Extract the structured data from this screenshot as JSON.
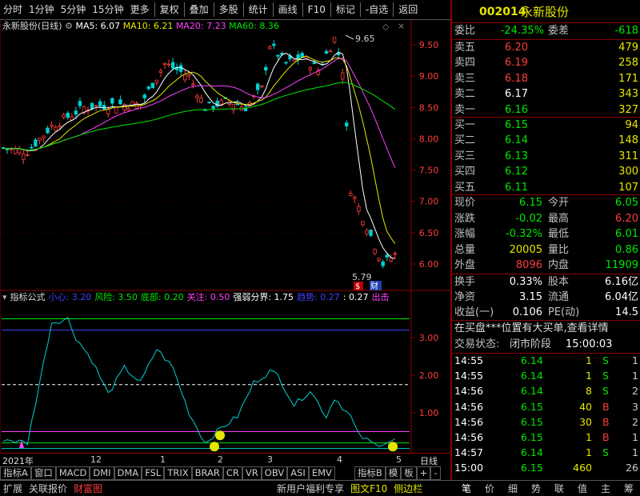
{
  "toolbar": [
    "分时",
    "1分钟",
    "5分钟",
    "15分钟",
    "更多",
    "复权",
    "叠加",
    "多股",
    "统计",
    "画线",
    "F10",
    "标记",
    "-自选",
    "返回"
  ],
  "ma": {
    "title": "永新股份(日线)",
    "ma5": "MA5: 6.07",
    "ma10": "MA10: 6.21",
    "ma20": "MA20: 7.23",
    "ma60": "MA60: 8.36"
  },
  "colors": {
    "up": "#ff3c3c",
    "down": "#00e600",
    "ma5": "#ffffff",
    "ma10": "#e6e600",
    "ma20": "#ff40ff",
    "ma60": "#00e600",
    "axis": "#8b0000",
    "grid": "#8b0000"
  },
  "price_axis": [
    "9.50",
    "9.00",
    "8.50",
    "8.00",
    "7.50",
    "7.00",
    "6.50",
    "6.00"
  ],
  "markers": {
    "high": "9.65",
    "low": "5.79",
    "s": "$",
    "cai": "财"
  },
  "ind": {
    "title": "指标公式",
    "xiaoxin": "小心: 3.20",
    "fengxian": "风险: 3.50",
    "dibu": "底部: 0.20",
    "guanzhu": "关注: 0.50",
    "qiangruo": "强弱分界: 1.75",
    "qushi": "趋势: 0.27",
    "v": ": 0.27",
    "chuji": "出击"
  },
  "ind_axis": [
    "3.00",
    "2.00",
    "1.00"
  ],
  "dates": [
    "2021年",
    "12",
    "1",
    "2",
    "3",
    "4",
    "5"
  ],
  "period": "日线",
  "tabs": [
    "指标A",
    "窗口",
    "MACD",
    "DMI",
    "DMA",
    "FSL",
    "TRIX",
    "BRAR",
    "CR",
    "VR",
    "OBV",
    "ASI",
    "EMV",
    "指标B",
    "模",
    "板",
    "+",
    "-"
  ],
  "bottom": [
    "扩展",
    "关联报价",
    "财富图",
    "新用户福利专享",
    "图文F10",
    "侧边栏"
  ],
  "bottom_right": [
    "笔",
    "价",
    "细",
    "势",
    "联",
    "值",
    "主",
    "筹"
  ],
  "quote": {
    "code": "002014",
    "name": "永新股份",
    "weibi_label": "委比",
    "weibi": "-24.35%",
    "weicha_label": "委差",
    "weicha": "-618",
    "sell": [
      {
        "l": "卖五",
        "p": "6.20",
        "v": "479"
      },
      {
        "l": "卖四",
        "p": "6.19",
        "v": "258"
      },
      {
        "l": "卖三",
        "p": "6.18",
        "v": "171"
      },
      {
        "l": "卖二",
        "p": "6.17",
        "v": "343"
      },
      {
        "l": "卖一",
        "p": "6.16",
        "v": "327"
      }
    ],
    "buy": [
      {
        "l": "买一",
        "p": "6.15",
        "v": "94"
      },
      {
        "l": "买二",
        "p": "6.14",
        "v": "148"
      },
      {
        "l": "买三",
        "p": "6.13",
        "v": "311"
      },
      {
        "l": "买四",
        "p": "6.12",
        "v": "300"
      },
      {
        "l": "买五",
        "p": "6.11",
        "v": "107"
      }
    ],
    "stats": [
      {
        "l": "现价",
        "v": "6.15",
        "l2": "今开",
        "v2": "6.05"
      },
      {
        "l": "涨跌",
        "v": "-0.02",
        "l2": "最高",
        "v2": "6.20"
      },
      {
        "l": "涨幅",
        "v": "-0.32%",
        "l2": "最低",
        "v2": "6.01"
      },
      {
        "l": "总量",
        "v": "20005",
        "l2": "量比",
        "v2": "0.86"
      },
      {
        "l": "外盘",
        "v": "8096",
        "l2": "内盘",
        "v2": "11909"
      }
    ],
    "fin": [
      {
        "l": "换手",
        "v": "0.33%",
        "l2": "股本",
        "v2": "6.16亿"
      },
      {
        "l": "净资",
        "v": "3.15",
        "l2": "流通",
        "v2": "6.04亿"
      },
      {
        "l": "收益(一)",
        "v": "0.106",
        "l2": "PE(动)",
        "v2": "14.5"
      }
    ],
    "notice": "在买盘***位置有大买单,查看详情",
    "status_label": "交易状态:",
    "status": "闭市阶段",
    "status_time": "15:00:03",
    "trades": [
      {
        "t": "14:55",
        "p": "6.14",
        "v": "1",
        "d": "S",
        "n": "1"
      },
      {
        "t": "14:55",
        "p": "6.14",
        "v": "1",
        "d": "S",
        "n": "1"
      },
      {
        "t": "14:56",
        "p": "6.14",
        "v": "8",
        "d": "S",
        "n": "2"
      },
      {
        "t": "14:56",
        "p": "6.15",
        "v": "40",
        "d": "B",
        "n": "3"
      },
      {
        "t": "14:56",
        "p": "6.15",
        "v": "30",
        "d": "B",
        "n": "2"
      },
      {
        "t": "14:56",
        "p": "6.15",
        "v": "1",
        "d": "B",
        "n": "1"
      },
      {
        "t": "14:57",
        "p": "6.14",
        "v": "1",
        "d": "S",
        "n": "1"
      },
      {
        "t": "15:00",
        "p": "6.15",
        "v": "460",
        "d": "",
        "n": "26"
      }
    ]
  }
}
